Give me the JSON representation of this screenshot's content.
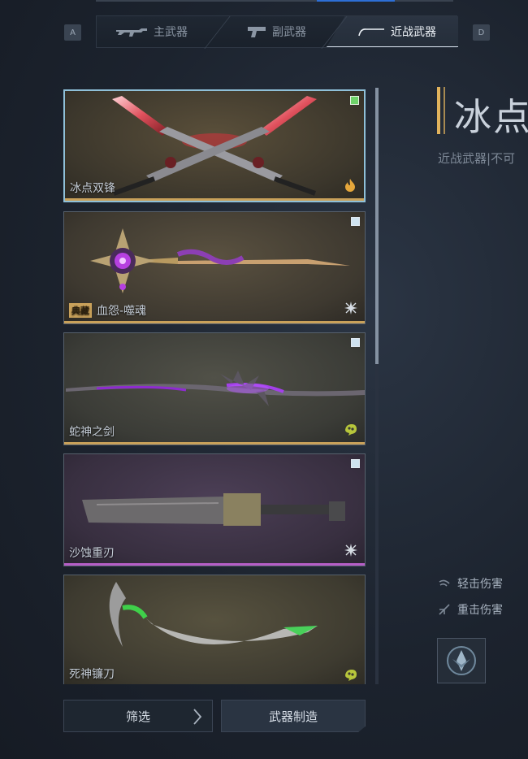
{
  "hints": {
    "left_key": "A",
    "right_key": "D"
  },
  "tabs": [
    {
      "label": "主武器",
      "icon": "rifle-icon",
      "active": false
    },
    {
      "label": "副武器",
      "icon": "pistol-icon",
      "active": false
    },
    {
      "label": "近战武器",
      "icon": "blade-icon",
      "active": true
    }
  ],
  "weapons": [
    {
      "name": "冰点双锋",
      "tag": "",
      "selected": true,
      "checked": true,
      "element": "fire-icon",
      "rarity_color": "#c9a15a",
      "element_color": "#e6a73b",
      "bg": "#4a4334"
    },
    {
      "name": "血怨-噬魂",
      "tag": "典藏",
      "selected": false,
      "checked": false,
      "element": "burst-icon",
      "rarity_color": "#c9a15a",
      "element_color": "#d7dde4",
      "bg": "#45403a"
    },
    {
      "name": "蛇神之剑",
      "tag": "",
      "selected": false,
      "checked": false,
      "element": "toxic-icon",
      "rarity_color": "#c9a15a",
      "element_color": "#b7c63b",
      "bg": "#3e403c"
    },
    {
      "name": "沙蚀重刃",
      "tag": "",
      "selected": false,
      "checked": false,
      "element": "burst-icon",
      "rarity_color": "#b65ec7",
      "element_color": "#d7dde4",
      "bg": "#3d3445"
    },
    {
      "name": "死神镰刀",
      "tag": "",
      "selected": false,
      "checked": false,
      "element": "toxic-icon",
      "rarity_color": "#c9a15a",
      "element_color": "#b7c63b",
      "bg": "#403f36"
    }
  ],
  "buttons": {
    "filter": "筛选",
    "craft": "武器制造"
  },
  "detail": {
    "title": "冰点",
    "subtitle": "近战武器|不可",
    "light_attack": "轻击伤害",
    "heavy_attack": "重击伤害"
  }
}
